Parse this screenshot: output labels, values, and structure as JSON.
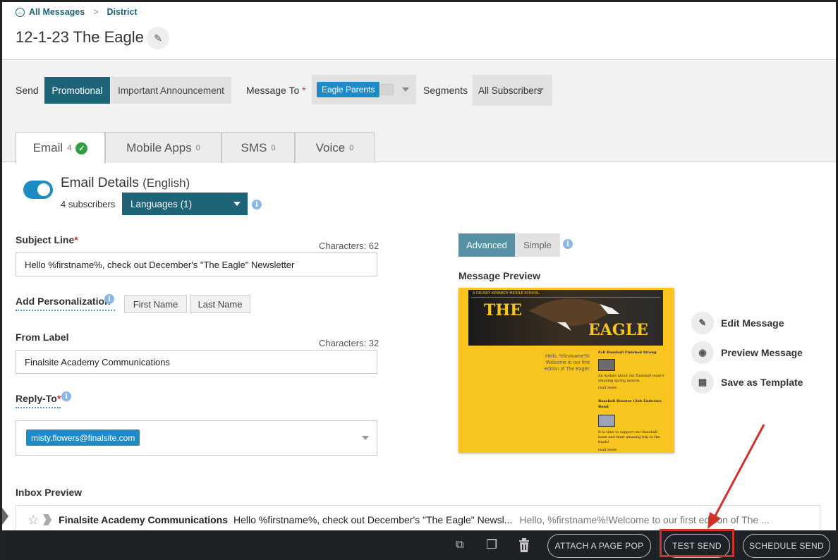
{
  "breadcrumb": {
    "back_label": "All Messages",
    "current": "District"
  },
  "page_title": "12-1-23 The Eagle",
  "send": {
    "label": "Send",
    "options": [
      "Promotional",
      "Important Announcement"
    ],
    "selected": "Promotional"
  },
  "message_to": {
    "label": "Message To",
    "required_mark": "*",
    "recipient": "Eagle Parents"
  },
  "segments": {
    "label": "Segments",
    "value": "All Subscribers"
  },
  "tabs": [
    {
      "label": "Email",
      "count": "4",
      "active": true
    },
    {
      "label": "Mobile Apps",
      "count": "0"
    },
    {
      "label": "SMS",
      "count": "0"
    },
    {
      "label": "Voice",
      "count": "0"
    }
  ],
  "email_details": {
    "title": "Email Details",
    "language": "(English)",
    "subscribers": "4 subscribers",
    "languages_button": "Languages (1)"
  },
  "subject": {
    "label": "Subject Line",
    "required_mark": "*",
    "characters": "Characters: 62",
    "value": "Hello %firstname%, check out December's \"The Eagle\" Newsletter"
  },
  "personalization": {
    "label": "Add Personalization",
    "buttons": [
      "First Name",
      "Last Name"
    ]
  },
  "from_label": {
    "label": "From Label",
    "characters": "Characters: 32",
    "value": "Finalsite Academy Communications"
  },
  "reply_to": {
    "label": "Reply-To",
    "required_mark": "*",
    "email": "misty.flowers@finalsite.com"
  },
  "editor_mode": {
    "options": [
      "Advanced",
      "Simple"
    ],
    "selected": "Advanced"
  },
  "message_preview": {
    "label": "Message Preview",
    "newsletter": {
      "school": "A DRUSKY KENNEDY MIDDLE SCHOOL",
      "title_left": "THE",
      "title_right": "EAGLE",
      "greeting": "Hello, %firstname%! Welcome to our first edition of The Eagle!",
      "article1_title": "Fall Baseball Finished Strong",
      "article1_text": "An update about our Baseball team's amazing spring season.",
      "article1_more": "read more",
      "article2_title": "Baseball Booster Club Endorses Bond",
      "article2_text": "It is time to support our Baseball team and their amazing trip to the finals!",
      "article2_more": "read more"
    }
  },
  "actions": [
    "Edit Message",
    "Preview Message",
    "Save as Template"
  ],
  "inbox_preview": {
    "label": "Inbox Preview",
    "from": "Finalsite Academy Communications",
    "subject": "Hello %firstname%, check out December's \"The Eagle\" Newsl...",
    "snippet": "Hello, %firstname%!Welcome to our first edition of The ..."
  },
  "footer": {
    "attach_label": "ATTACH A PAGE POP",
    "test_send_label": "TEST SEND",
    "schedule_label": "SCHEDULE SEND"
  },
  "colors": {
    "primary": "#1e6479",
    "chip": "#1f8bc6",
    "highlight": "#d0322b",
    "preview_bg": "#f7c51e"
  }
}
